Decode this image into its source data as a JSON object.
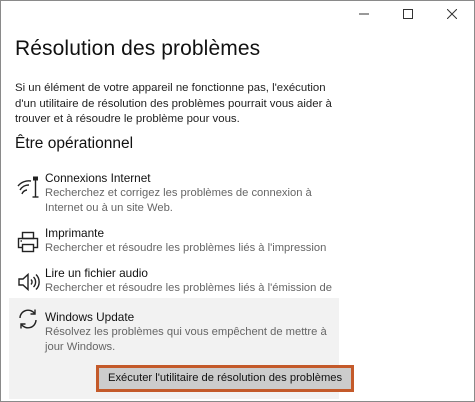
{
  "window": {
    "title": "Résolution des problèmes",
    "caption": {
      "minimize_icon": "minimize-icon",
      "maximize_icon": "maximize-icon",
      "close_icon": "close-icon"
    }
  },
  "intro": "Si un élément de votre appareil ne fonctionne pas, l'exécution d'un utilitaire de résolution des problèmes pourrait vous aider à trouver et à résoudre le problème pour vous.",
  "section": {
    "heading": "Être opérationnel"
  },
  "items": [
    {
      "icon": "network-icon",
      "name": "Connexions Internet",
      "description": "Recherchez et corrigez les problèmes de connexion à Internet ou à un site Web."
    },
    {
      "icon": "printer-icon",
      "name": "Imprimante",
      "description": "Rechercher et résoudre les problèmes liés à l'impression"
    },
    {
      "icon": "speaker-icon",
      "name": "Lire un fichier audio",
      "description": "Rechercher et résoudre les problèmes liés à l'émission de sons"
    },
    {
      "icon": "sync-icon",
      "name": "Windows Update",
      "description": "Résolvez les problèmes qui vous empêchent de mettre à jour Windows.",
      "selected": true
    }
  ],
  "run_button": {
    "label": "Exécuter l'utilitaire de résolution des problèmes"
  },
  "colors": {
    "highlight_border": "#c45a2a",
    "selected_bg": "#f2f2f2",
    "button_bg": "#cccccc"
  }
}
